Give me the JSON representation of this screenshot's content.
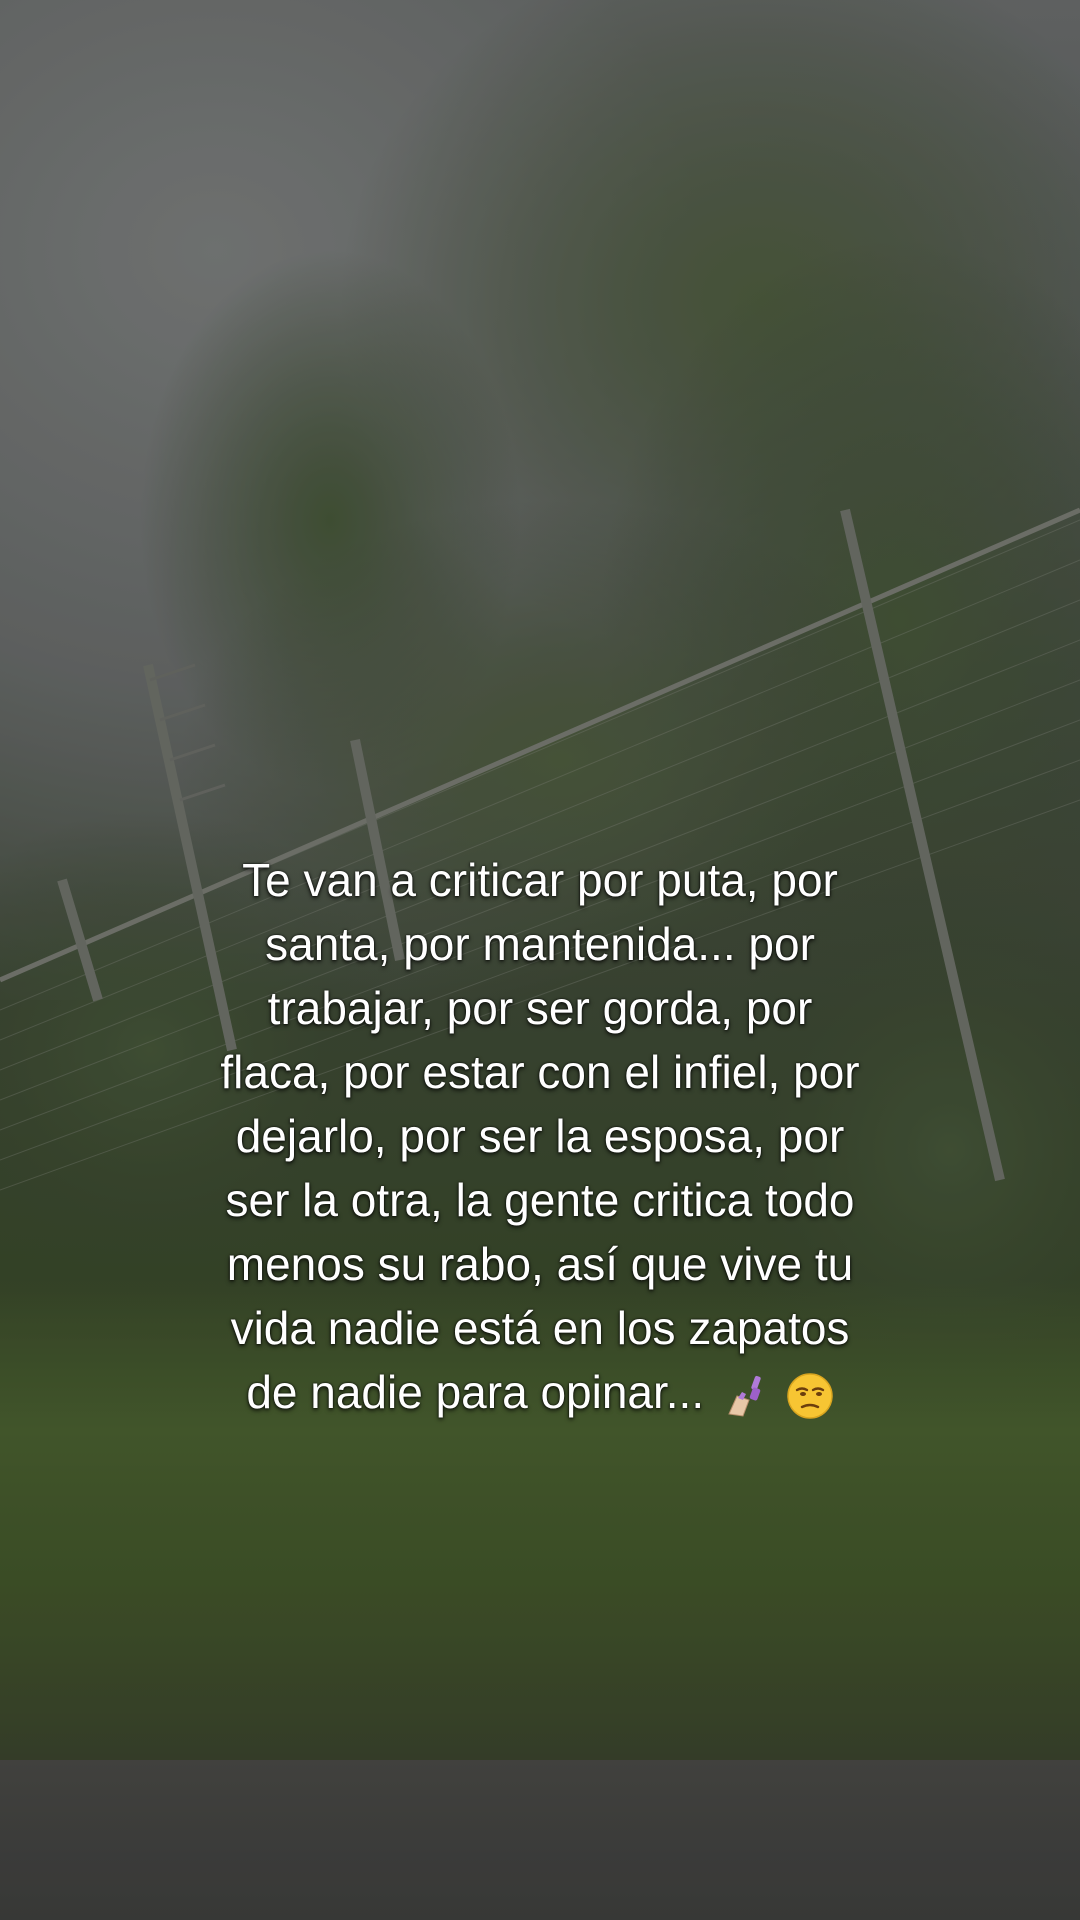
{
  "caption": {
    "lines": [
      "Te van a criticar por puta, por",
      "santa, por mantenida... por",
      "trabajar, por ser gorda, por",
      "flaca, por estar con el infiel, por",
      "dejarlo, por ser la esposa, por",
      "ser la otra, la gente critica todo",
      "menos su rabo, así que vive tu",
      "vida nadie está en los zapatos",
      "de nadie para opinar..."
    ],
    "emojis": [
      "nail-polish-icon",
      "unamused-face-icon"
    ]
  },
  "colors": {
    "text": "#ffffff",
    "nail_polish": "#b07ad8",
    "face": "#f7c533"
  }
}
